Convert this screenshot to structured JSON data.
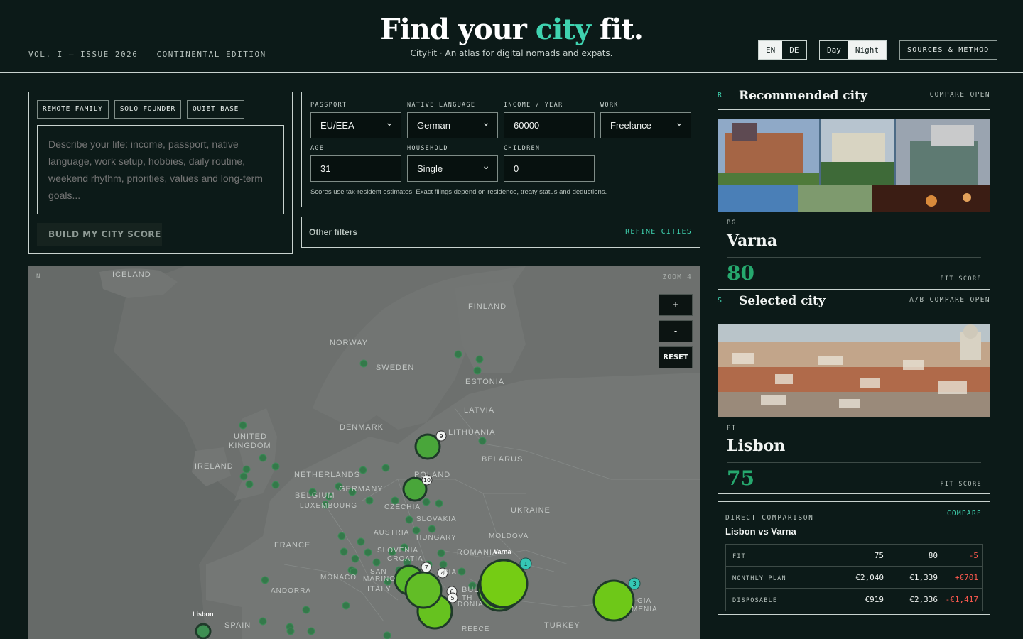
{
  "header": {
    "issue": [
      "VOL. I — ISSUE 2026",
      "CONTINENTAL EDITION"
    ],
    "title_pre": "Find your ",
    "title_accent": "city",
    "title_post": " fit.",
    "subtitle": "CityFit · An atlas for digital nomads and expats.",
    "lang": [
      "EN",
      "DE"
    ],
    "mode": [
      "Day",
      "Night"
    ],
    "sources": "SOURCES & METHOD"
  },
  "profile": {
    "chips": [
      "REMOTE FAMILY",
      "SOLO FOUNDER",
      "QUIET BASE"
    ],
    "placeholder": "Describe your life: income, passport, native language, work setup, hobbies, daily routine, weekend rhythm, priorities, values and long-term goals...",
    "build": "BUILD MY CITY SCORE"
  },
  "params": {
    "passport_label": "PASSPORT",
    "passport": "EU/EEA",
    "language_label": "NATIVE LANGUAGE",
    "language": "German",
    "income_label": "INCOME / YEAR",
    "income": "60000",
    "work_label": "WORK",
    "work": "Freelance",
    "age_label": "AGE",
    "age": "31",
    "household_label": "HOUSEHOLD",
    "household": "Single",
    "children_label": "CHILDREN",
    "children": "0",
    "note": "Scores use tax-resident estimates. Exact filings depend on residence, treaty status and deductions."
  },
  "filters": {
    "label": "Other filters",
    "action": "REFINE CITIES"
  },
  "map": {
    "corner": "N",
    "zoom": "ZOOM 4",
    "plus": "+",
    "minus": "-",
    "reset": "RESET",
    "countries": [
      "ICELAND",
      "FINLAND",
      "NORWAY",
      "SWEDEN",
      "ESTONIA",
      "LATVIA",
      "DENMARK",
      "LITHUANIA",
      "UNITED",
      "KINGDOM",
      "IRELAND",
      "BELARUS",
      "NETHERLANDS",
      "POLAND",
      "GERMANY",
      "BELGIUM",
      "LUXEMBOURG",
      "CZECHIA",
      "UKRAINE",
      "SLOVAKIA",
      "AUSTRIA",
      "HUNGARY",
      "MOLDOVA",
      "FRANCE",
      "SLOVENIA",
      "CROATIA",
      "ROMANIA",
      "SAN",
      "MARINO",
      "MONACO",
      "BIA",
      "ITALY",
      "BUL",
      "TH",
      "DONIA",
      "ANDORRA",
      "SPAIN",
      "REECE",
      "TURKEY",
      "GIA",
      "MENIA"
    ],
    "cities": [
      "Varna",
      "Lisbon"
    ],
    "badges": [
      "9",
      "10",
      "7",
      "4",
      "6",
      "5",
      "1",
      "3"
    ]
  },
  "recommended": {
    "tag": "R",
    "heading": "Recommended city",
    "action": "COMPARE OPEN",
    "country": "BG",
    "city": "Varna",
    "score": "80",
    "score_label": "FIT SCORE"
  },
  "selected": {
    "tag": "S",
    "heading": "Selected city",
    "action": "A/B COMPARE OPEN",
    "country": "PT",
    "city": "Lisbon",
    "score": "75",
    "score_label": "FIT SCORE"
  },
  "comparison": {
    "kicker": "DIRECT COMPARISON",
    "title": "Lisbon vs Varna",
    "action": "COMPARE",
    "rows": [
      {
        "metric": "FIT",
        "a": "75",
        "b": "80",
        "delta": "-5"
      },
      {
        "metric": "MONTHLY PLAN",
        "a": "€2,040",
        "b": "€1,339",
        "delta": "+€701"
      },
      {
        "metric": "DISPOSABLE",
        "a": "€919",
        "b": "€2,336",
        "delta": "-€1,417"
      }
    ]
  },
  "colors": {
    "accent": "#3fd3b0",
    "score": "#26a86e",
    "negative": "#ff5a4f",
    "bg": "#0c1a18"
  }
}
